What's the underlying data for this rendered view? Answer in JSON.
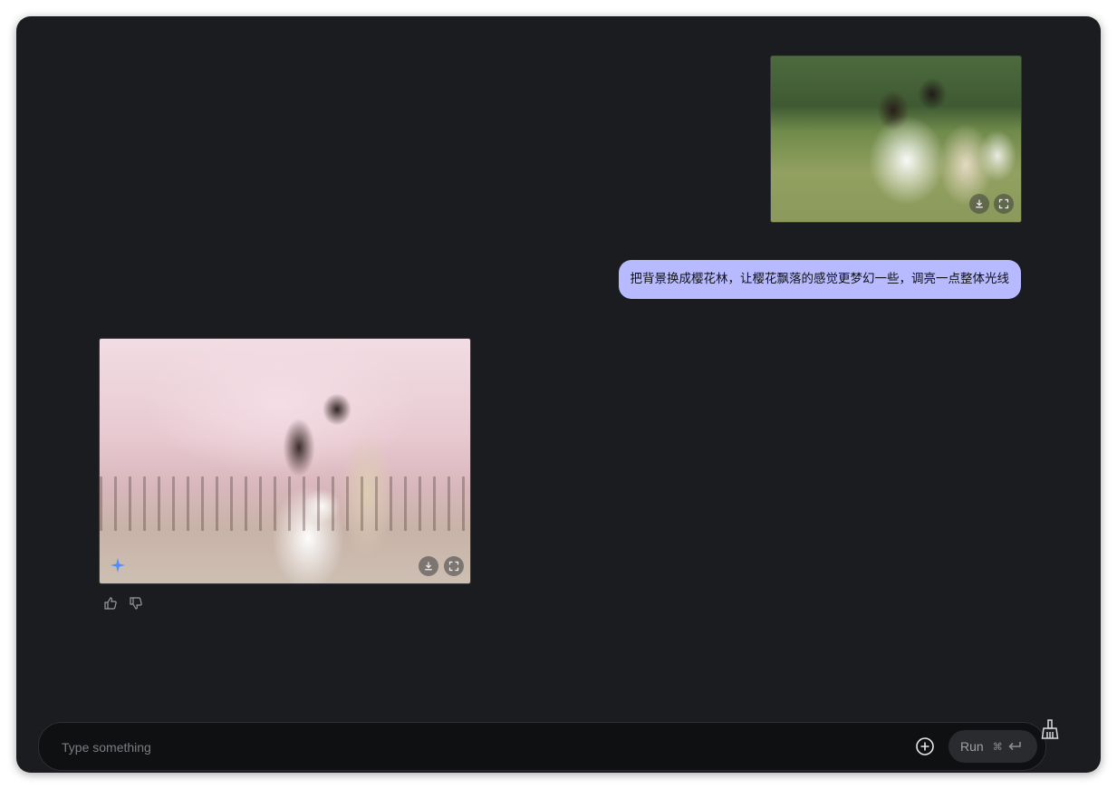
{
  "conversation": {
    "user_image": {
      "alt": "",
      "download_icon": "download-icon",
      "expand_icon": "fullscreen-icon"
    },
    "user_message": "把背景换成樱花林，让樱花飘落的感觉更梦幻一些，调亮一点整体光线",
    "ai_image": {
      "alt": "",
      "badge_icon": "sparkle-icon",
      "download_icon": "download-icon",
      "expand_icon": "fullscreen-icon"
    },
    "feedback": {
      "like_icon": "thumbs-up-icon",
      "dislike_icon": "thumbs-down-icon"
    }
  },
  "composer": {
    "placeholder": "Type something",
    "run_label": "Run",
    "shortcut_symbol": "⌘",
    "add_icon": "plus-circle-icon",
    "clear_icon": "broom-icon"
  },
  "colors": {
    "window_bg": "#1b1c1f",
    "bubble_bg": "#b7baff",
    "accent_sparkle": "#4c8dff"
  }
}
